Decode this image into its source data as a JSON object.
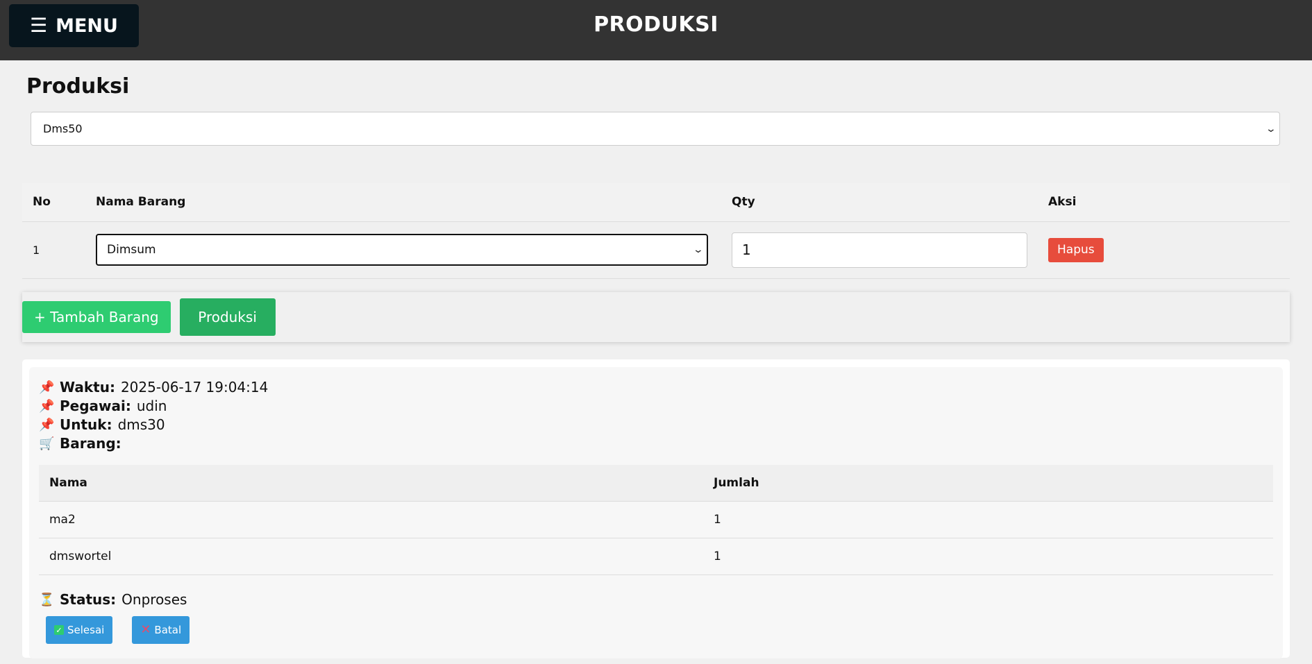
{
  "header": {
    "menu_label": "MENU",
    "title": "PRODUKSI"
  },
  "page": {
    "heading": "Produksi",
    "target_select_value": "Dms50"
  },
  "items_table": {
    "headers": [
      "No",
      "Nama Barang",
      "Qty",
      "Aksi"
    ],
    "rows": [
      {
        "no": "1",
        "nama": "Dimsum",
        "qty": "1",
        "aksi": "Hapus"
      }
    ]
  },
  "actions": {
    "tambah_label": "+ Tambah Barang",
    "produksi_label": "Produksi"
  },
  "record": {
    "waktu_label": "Waktu:",
    "waktu_value": "2025-06-17 19:04:14",
    "pegawai_label": "Pegawai:",
    "pegawai_value": "udin",
    "untuk_label": "Untuk:",
    "untuk_value": "dms30",
    "barang_label": "Barang:",
    "table_headers": [
      "Nama",
      "Jumlah"
    ],
    "table_rows": [
      {
        "nama": "ma2",
        "jumlah": "1"
      },
      {
        "nama": "dmswortel",
        "jumlah": "1"
      }
    ],
    "status_label": "Status:",
    "status_value": "Onproses",
    "selesai_label": "Selesai",
    "batal_label": "Batal"
  },
  "icons": {
    "menu": "hamburger-icon",
    "pin": "pushpin-icon",
    "cart": "shopping-cart-icon",
    "hourglass": "hourglass-icon",
    "check": "check-box-icon",
    "cross": "cross-icon"
  },
  "colors": {
    "topbar": "#333333",
    "menu_button": "#07151d",
    "hapus": "#e74c3c",
    "tambah": "#2ecc71",
    "produksi": "#27ae60",
    "blue_button": "#3498db"
  }
}
